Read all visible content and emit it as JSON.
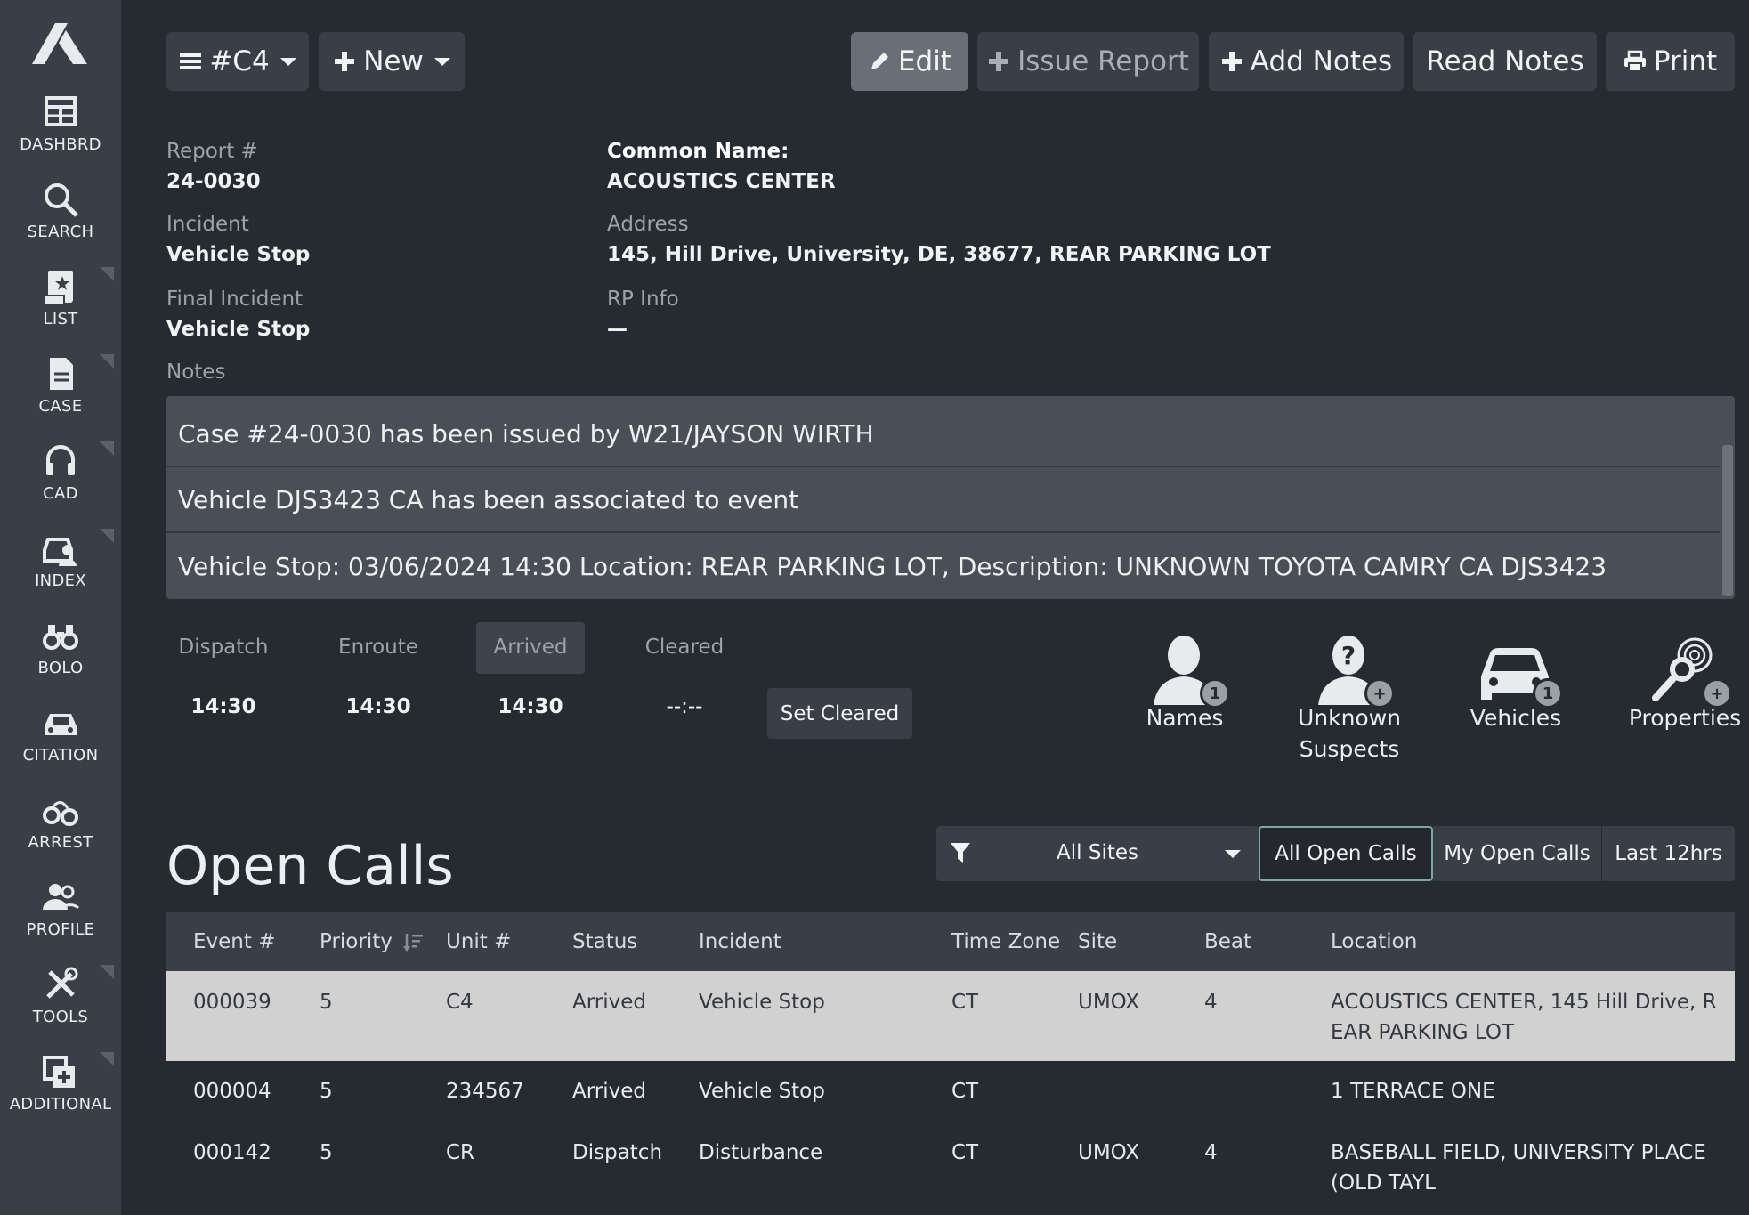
{
  "sidebar": {
    "items": [
      {
        "label": "DASHBRD",
        "icon": "grid-icon"
      },
      {
        "label": "SEARCH",
        "icon": "search-icon"
      },
      {
        "label": "LIST",
        "icon": "list-icon"
      },
      {
        "label": "CASE",
        "icon": "document-icon"
      },
      {
        "label": "CAD",
        "icon": "headset-icon"
      },
      {
        "label": "INDEX",
        "icon": "car-person-icon"
      },
      {
        "label": "BOLO",
        "icon": "binoculars-icon"
      },
      {
        "label": "CITATION",
        "icon": "car-icon"
      },
      {
        "label": "ARREST",
        "icon": "handcuffs-icon"
      },
      {
        "label": "PROFILE",
        "icon": "people-icon"
      },
      {
        "label": "TOOLS",
        "icon": "tools-icon"
      },
      {
        "label": "ADDITIONAL",
        "icon": "add-window-icon"
      }
    ]
  },
  "toolbar": {
    "unit_label": "#C4",
    "new_label": "New",
    "edit_label": "Edit",
    "issue_report_label": "Issue Report",
    "add_notes_label": "Add Notes",
    "read_notes_label": "Read Notes",
    "print_label": "Print"
  },
  "report": {
    "report_label": "Report #",
    "report_value": "24-0030",
    "incident_label": "Incident",
    "incident_value": "Vehicle Stop",
    "final_incident_label": "Final Incident",
    "final_incident_value": "Vehicle Stop",
    "common_name_label": "Common Name:",
    "common_name_value": "ACOUSTICS CENTER",
    "address_label": "Address",
    "address_value": "145, Hill Drive, University, DE, 38677, REAR PARKING LOT",
    "rp_info_label": "RP Info",
    "rp_info_value": "—",
    "notes_label": "Notes"
  },
  "notes": [
    "Case #24-0030 has been issued by W21/JAYSON WIRTH",
    "Vehicle DJS3423 CA has been associated to event",
    "Vehicle Stop: 03/06/2024 14:30 Location: REAR PARKING LOT, Description: UNKNOWN TOYOTA CAMRY CA DJS3423"
  ],
  "times": {
    "dispatch_label": "Dispatch",
    "dispatch_value": "14:30",
    "enroute_label": "Enroute",
    "enroute_value": "14:30",
    "arrived_label": "Arrived",
    "arrived_value": "14:30",
    "cleared_label": "Cleared",
    "cleared_value": "--:--",
    "set_cleared_label": "Set Cleared"
  },
  "associations": {
    "names": {
      "label": "Names",
      "badge": "1"
    },
    "unknown_suspects": {
      "label_line1": "Unknown",
      "label_line2": "Suspects",
      "badge": "+"
    },
    "vehicles": {
      "label": "Vehicles",
      "badge": "1"
    },
    "properties": {
      "label": "Properties",
      "badge": "+"
    }
  },
  "open_calls": {
    "title": "Open Calls",
    "site_filter": "All Sites",
    "segments": [
      "All Open Calls",
      "My Open Calls",
      "Last 12hrs"
    ],
    "columns": [
      "Event #",
      "Priority",
      "Unit #",
      "Status",
      "Incident",
      "Time Zone",
      "Site",
      "Beat",
      "Location"
    ],
    "rows": [
      {
        "event": "000039",
        "priority": "5",
        "unit": "C4",
        "status": "Arrived",
        "incident": "Vehicle Stop",
        "tz": "CT",
        "site": "UMOX",
        "beat": "4",
        "loc1": "ACOUSTICS CENTER, 145 Hill Drive, R",
        "loc2": "EAR PARKING LOT"
      },
      {
        "event": "000004",
        "priority": "5",
        "unit": "234567",
        "status": "Arrived",
        "incident": "Vehicle Stop",
        "tz": "CT",
        "site": "",
        "beat": "",
        "loc1": "1 TERRACE ONE",
        "loc2": ""
      },
      {
        "event": "000142",
        "priority": "5",
        "unit": "CR",
        "status": "Dispatch",
        "incident": "Disturbance",
        "tz": "CT",
        "site": "UMOX",
        "beat": "4",
        "loc1": "BASEBALL FIELD, UNIVERSITY PLACE",
        "loc2": "(OLD TAYL"
      }
    ]
  },
  "colors": {
    "background": "#262a31",
    "sidebar": "#3a3f47",
    "selected_row": "#d1d1d1"
  }
}
